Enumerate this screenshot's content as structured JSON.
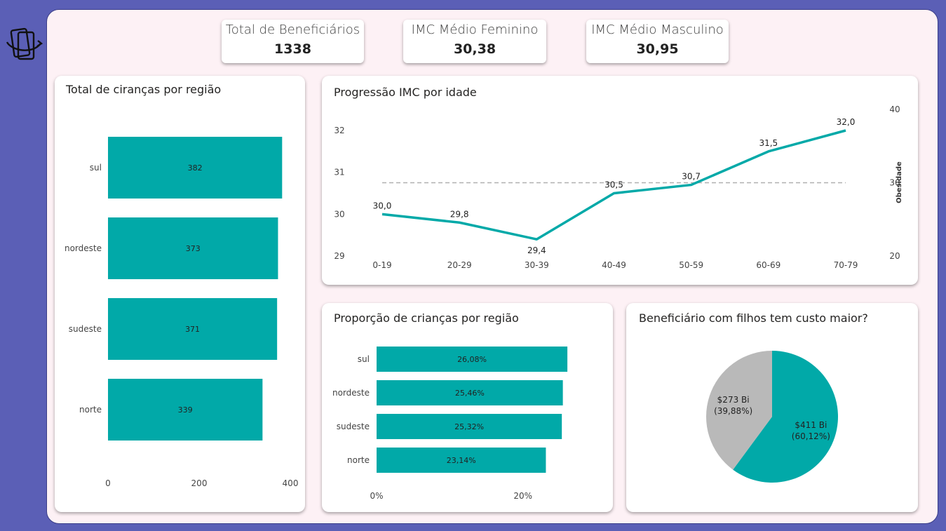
{
  "colors": {
    "frame_bg": "#5b5fb6",
    "canvas_bg": "#fdf1f5",
    "accent": "#01a9a8",
    "gray": "#b9b9b9"
  },
  "logo": {
    "icon": "rotate-device-icon"
  },
  "kpis": [
    {
      "label": "Total de Beneficiários",
      "value": "1338"
    },
    {
      "label": "IMC Médio Feminino",
      "value": "30,38"
    },
    {
      "label": "IMC Médio Masculino",
      "value": "30,95"
    }
  ],
  "cards": {
    "bar": {
      "title": "Total de ciranças por região"
    },
    "line": {
      "title": "Progressão IMC por idade"
    },
    "prop": {
      "title": "Proporção de crianças por região"
    },
    "pie": {
      "title": "Beneficiário com filhos tem custo maior?"
    }
  },
  "chart_data": [
    {
      "type": "bar",
      "orientation": "horizontal",
      "title": "Total de ciranças por região",
      "categories": [
        "sul",
        "nordeste",
        "sudeste",
        "norte"
      ],
      "values": [
        382,
        373,
        371,
        339
      ],
      "data_labels": [
        "382",
        "373",
        "371",
        "339"
      ],
      "xlim": [
        0,
        400
      ],
      "x_ticks": [
        0,
        200,
        400
      ],
      "x_tick_labels": [
        "0",
        "200",
        "400"
      ],
      "color": "#01a9a8"
    },
    {
      "type": "line",
      "title": "Progressão IMC por idade",
      "categories": [
        "0-19",
        "20-29",
        "30-39",
        "40-49",
        "50-59",
        "60-69",
        "70-79"
      ],
      "values": [
        30.0,
        29.8,
        29.4,
        30.5,
        30.7,
        31.5,
        32.0
      ],
      "data_labels": [
        "30,0",
        "29,8",
        "29,4",
        "30,5",
        "30,7",
        "31,5",
        "32,0"
      ],
      "ylim": [
        29,
        32
      ],
      "y_ticks": [
        29,
        30,
        31,
        32
      ],
      "y_tick_labels": [
        "29",
        "30",
        "31",
        "32"
      ],
      "y2label": "Obesidade",
      "y2lim": [
        20,
        40
      ],
      "y2_ticks": [
        20,
        30,
        40
      ],
      "y2_tick_labels": [
        "20",
        "30",
        "40"
      ],
      "reference_line": {
        "value": 30,
        "axis": "y2",
        "style": "dashed"
      },
      "color": "#01a9a8"
    },
    {
      "type": "bar",
      "orientation": "horizontal",
      "title": "Proporção de crianças por região",
      "categories": [
        "sul",
        "nordeste",
        "sudeste",
        "norte"
      ],
      "values": [
        26.08,
        25.46,
        25.32,
        23.14
      ],
      "data_labels": [
        "26,08%",
        "25,46%",
        "25,32%",
        "23,14%"
      ],
      "xlim": [
        0,
        25.4
      ],
      "x_ticks": [
        0,
        20
      ],
      "x_tick_labels": [
        "0%",
        "20%"
      ],
      "color": "#01a9a8"
    },
    {
      "type": "pie",
      "title": "Beneficiário com filhos tem custo maior?",
      "slices": [
        {
          "value": 60.12,
          "label_line1": "$411 Bi",
          "label_line2": "(60,12%)",
          "color": "#01a9a8"
        },
        {
          "value": 39.88,
          "label_line1": "$273 Bi",
          "label_line2": "(39,88%)",
          "color": "#b9b9b9"
        }
      ]
    }
  ]
}
